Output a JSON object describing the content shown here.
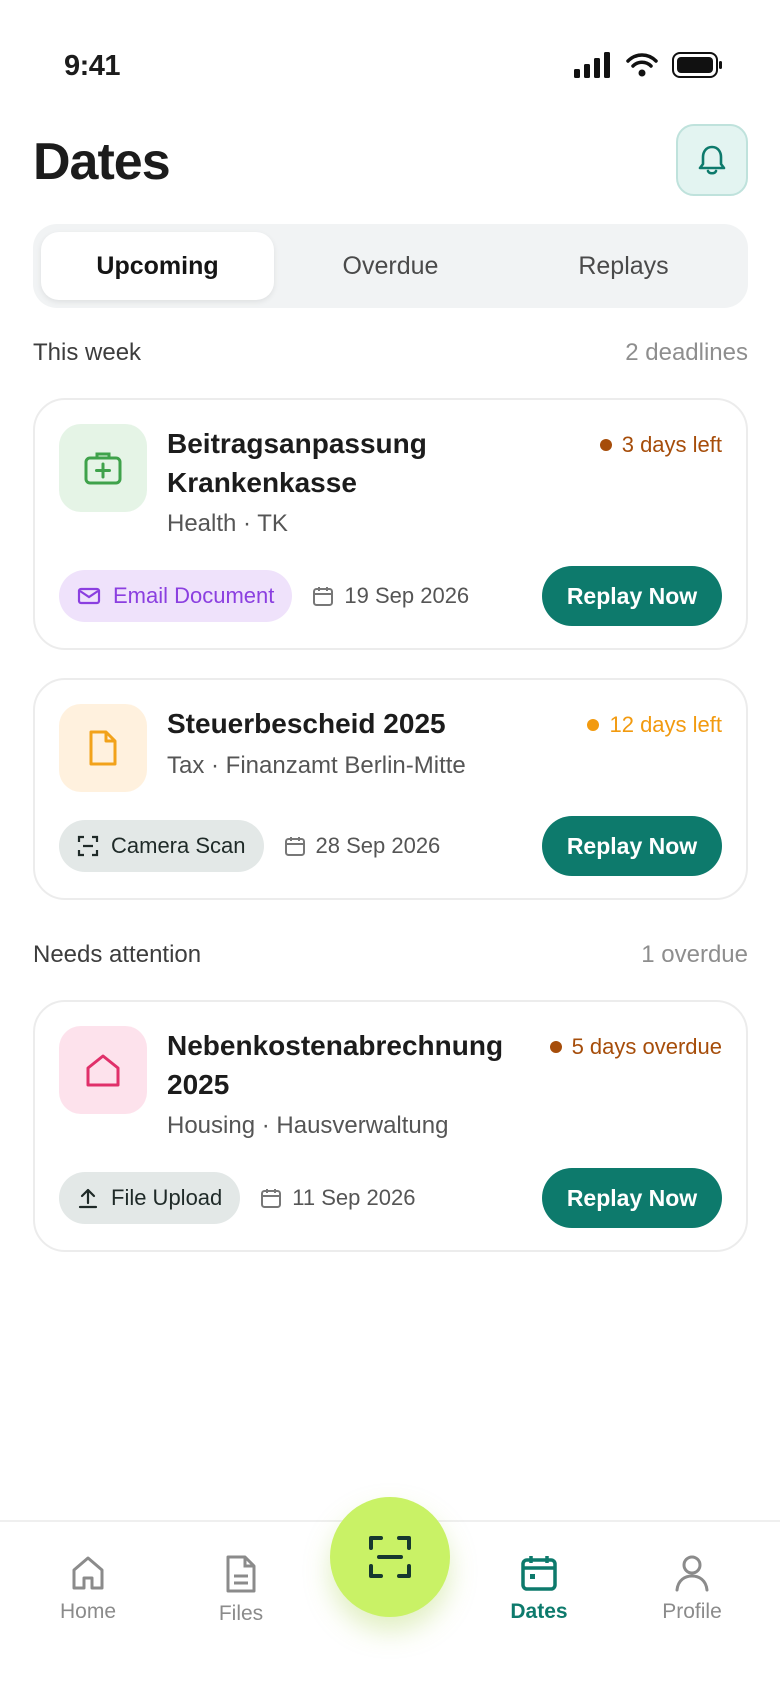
{
  "status_bar": {
    "time": "9:41"
  },
  "header": {
    "title": "Dates"
  },
  "tabs": [
    {
      "label": "Upcoming",
      "active": true
    },
    {
      "label": "Overdue",
      "active": false
    },
    {
      "label": "Replays",
      "active": false
    }
  ],
  "sections": [
    {
      "label": "This week",
      "count": "2 deadlines"
    },
    {
      "label": "Needs attention",
      "count": "1 overdue"
    }
  ],
  "cards": [
    {
      "icon": "medical-briefcase-icon",
      "title_line1": "Beitragsanpassung",
      "title_line2": "Krankenkasse",
      "subtitle": "Health · TK",
      "due": "3 days left",
      "due_color": "#a64d0a",
      "chip": "Email Document",
      "chip_icon": "mail-icon",
      "date": "19 Sep 2026",
      "button": "Replay Now"
    },
    {
      "icon": "document-icon",
      "title_line1": "Steuerbescheid 2025",
      "subtitle": "Tax · Finanzamt Berlin-Mitte",
      "due": "12 days left",
      "due_color": "#f29a0f",
      "chip": "Camera Scan",
      "chip_icon": "scan-icon",
      "date": "28 Sep 2026",
      "button": "Replay Now"
    },
    {
      "icon": "home-icon",
      "title_line1": "Nebenkostenabrechnung",
      "title_line2": "2025",
      "subtitle": "Housing · Hausverwaltung",
      "due": "5 days overdue",
      "due_color": "#a64d0a",
      "chip": "File Upload",
      "chip_icon": "upload-icon",
      "date": "11 Sep 2026",
      "button": "Replay Now"
    }
  ],
  "nav": [
    {
      "label": "Home",
      "icon": "home-icon"
    },
    {
      "label": "Files",
      "icon": "file-icon"
    },
    {
      "label": "Dates",
      "icon": "calendar-icon",
      "active": true
    },
    {
      "label": "Profile",
      "icon": "profile-icon"
    }
  ],
  "colors": {
    "accent": "#0d7a6c",
    "fab": "#c9f266"
  }
}
